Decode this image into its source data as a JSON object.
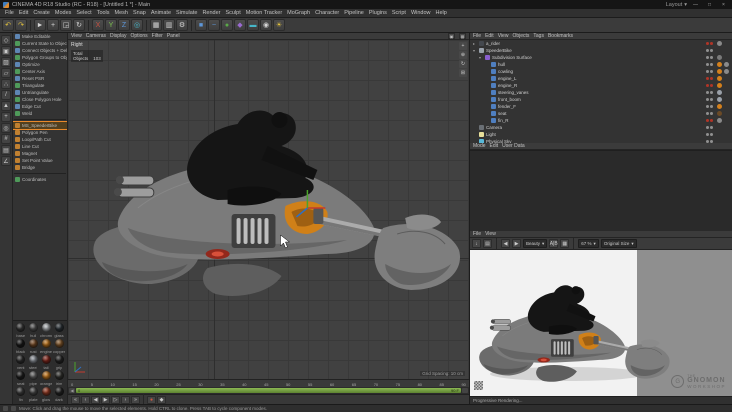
{
  "titlebar": {
    "app_title": "CINEMA 4D R18 Studio (RC - R18) - [Untitled 1 *] - Main",
    "layout_label": "Layout",
    "minimize": "—",
    "maximize": "□",
    "close": "×"
  },
  "menubar": {
    "items": [
      "File",
      "Edit",
      "Create",
      "Modes",
      "Select",
      "Tools",
      "Mesh",
      "Snap",
      "Animate",
      "Simulate",
      "Render",
      "Sculpt",
      "Motion Tracker",
      "MoGraph",
      "Character",
      "Pipeline",
      "Plugins",
      "Script",
      "Window",
      "Help"
    ]
  },
  "icons": {
    "undo": "↶",
    "redo": "↷",
    "select": "►",
    "move": "+",
    "scale": "◲",
    "rotate": "↻",
    "lock_x": "X",
    "lock_y": "Y",
    "lock_z": "Z",
    "coord_sys": "◎",
    "render_active": "▦",
    "render_pv": "▥",
    "render_settings": "⚙",
    "add_cube": "■",
    "add_spline": "~",
    "add_sds": "●",
    "add_deformer": "◆",
    "add_env": "▬",
    "add_camera": "◉",
    "add_light": "☀",
    "mode_make_editable": "◇",
    "mode_model": "▣",
    "mode_texture": "▨",
    "mode_workplane": "▱",
    "mode_points": "∴",
    "mode_edges": "/",
    "mode_polys": "▲",
    "mode_axis": "+",
    "mode_solo": "◎",
    "mode_snap": "#",
    "mode_lock": "▤",
    "mode_quantize": "∠",
    "nav_pan": "+",
    "nav_zoom": "⊕",
    "nav_rotate": "↻",
    "nav_max": "⊞",
    "panel_single": "▣",
    "panel_quad": "▦",
    "tp_start": "«",
    "tp_prevkey": "‹",
    "tp_prev": "◀",
    "tp_play": "▶",
    "tp_next": "▷",
    "tp_nextkey": "›",
    "tp_end": "»",
    "tp_record": "●",
    "tp_key": "◆",
    "rv_save": "↓",
    "rv_copy": "▤",
    "rv_back": "◀",
    "rv_fwd": "▶",
    "rv_ab": "A|B",
    "rv_grid": "▦",
    "dd_arrow": "▾",
    "wm_g": "G"
  },
  "left_panel": {
    "items": [
      "Make Editable",
      "Current State to Object",
      "Connect Objects + Delete",
      "Polygon Groups to Objects",
      "Optimize",
      "Center Axis",
      "Reset PSR",
      "Triangulate",
      "Untriangulate",
      "Close Polygon Hole",
      "Edge Cut",
      "Weld",
      "MS_SpeederBike",
      "Polygon Pen",
      "Loop/Path Cut",
      "Line Cut",
      "Magnet",
      "Set Point Value",
      "Bridge",
      "Coordinates"
    ]
  },
  "materials": {
    "items": [
      {
        "name": "base",
        "style": "--c:#3a3a3a"
      },
      {
        "name": "hull",
        "style": "--c:#565656"
      },
      {
        "name": "chrome",
        "style": "--c:#c0c4c8"
      },
      {
        "name": "glass",
        "style": "--c:#2a3238"
      },
      {
        "name": "black",
        "style": "--c:#141414"
      },
      {
        "name": "rust",
        "style": "--c:#7a4a22"
      },
      {
        "name": "engine",
        "style": "--c:#c87818"
      },
      {
        "name": "copper",
        "style": "--c:#8a5a28"
      },
      {
        "name": "vent",
        "style": "--c:#2e2e2e"
      },
      {
        "name": "steel",
        "style": "--c:#9aa0a8"
      },
      {
        "name": "tail",
        "style": "--c:#8a2418"
      },
      {
        "name": "grip",
        "style": "--c:#242424"
      },
      {
        "name": "seat",
        "style": "--c:#1a1a1a"
      },
      {
        "name": "pipe",
        "style": "--c:#6a6a6a"
      },
      {
        "name": "orange",
        "style": "--c:#d4801c"
      },
      {
        "name": "trim",
        "style": "--c:#32322e"
      },
      {
        "name": "fin",
        "style": "--c:#3e3e3e"
      },
      {
        "name": "plate",
        "style": "--c:#4a4a4a"
      },
      {
        "name": "glow",
        "style": "--c:#a03a20"
      },
      {
        "name": "dark",
        "style": "--c:#202020"
      }
    ]
  },
  "viewport": {
    "menu": [
      "View",
      "Cameras",
      "Display",
      "Options",
      "Filter",
      "Panel"
    ],
    "view_label": "Right",
    "hud": [
      {
        "label": "Total",
        "value": ""
      },
      {
        "label": "Objects",
        "value": "103"
      }
    ],
    "grid_label": "Grid Spacing: 10 cm"
  },
  "timeline": {
    "ticks": [
      "0",
      "5",
      "10",
      "15",
      "20",
      "25",
      "30",
      "35",
      "40",
      "45",
      "50",
      "55",
      "60",
      "65",
      "70",
      "75",
      "80",
      "85",
      "90"
    ],
    "range_start": "0",
    "range_end": "90 F"
  },
  "object_manager": {
    "menu": [
      "File",
      "Edit",
      "View",
      "Objects",
      "Tags",
      "Bookmarks"
    ],
    "items": [
      {
        "name": "a_rider",
        "arrow": "▸",
        "indent": "padding-left:3px",
        "icon": "--c:#44484e",
        "dots": "--d1:#b13527;--d2:#b13527",
        "tag1": "--t:#8a8a8a",
        "tag2": ""
      },
      {
        "name": "SpeederBike",
        "arrow": "▾",
        "indent": "padding-left:3px",
        "icon": "--c:#9aa2ac",
        "dots": "--d1:#909090;--d2:#909090",
        "tag1": "",
        "tag2": ""
      },
      {
        "name": "Subdivision Surface",
        "arrow": "▾",
        "indent": "padding-left:9px",
        "icon": "--c:#8a5fd0",
        "dots": "--d1:#909090;--d2:#909090",
        "tag1": "--t:#7a7a7a",
        "tag2": ""
      },
      {
        "name": "hull",
        "arrow": "",
        "indent": "padding-left:15px",
        "icon": "--c:#4f7fc0",
        "dots": "--d1:#909090;--d2:#909090",
        "tag1": "--t:#d4801c",
        "tag2": "--t:#8a8a8a"
      },
      {
        "name": "cowling",
        "arrow": "",
        "indent": "padding-left:15px",
        "icon": "--c:#4f7fc0",
        "dots": "--d1:#909090;--d2:#909090",
        "tag1": "--t:#d4801c",
        "tag2": "--t:#8a8a8a"
      },
      {
        "name": "engine_L",
        "arrow": "",
        "indent": "padding-left:15px",
        "icon": "--c:#4f7fc0",
        "dots": "--d1:#b13527;--d2:#b13527",
        "tag1": "--t:#d4801c",
        "tag2": ""
      },
      {
        "name": "engine_R",
        "arrow": "",
        "indent": "padding-left:15px",
        "icon": "--c:#4f7fc0",
        "dots": "--d1:#b13527;--d2:#b13527",
        "tag1": "--t:#d4801c",
        "tag2": ""
      },
      {
        "name": "steering_vanes",
        "arrow": "",
        "indent": "padding-left:15px",
        "icon": "--c:#4f7fc0",
        "dots": "--d1:#909090;--d2:#909090",
        "tag1": "--t:#9aa0a8",
        "tag2": ""
      },
      {
        "name": "front_boom",
        "arrow": "",
        "indent": "padding-left:15px",
        "icon": "--c:#4f7fc0",
        "dots": "--d1:#909090;--d2:#909090",
        "tag1": "--t:#9aa0a8",
        "tag2": ""
      },
      {
        "name": "fender_F",
        "arrow": "",
        "indent": "padding-left:15px",
        "icon": "--c:#4f7fc0",
        "dots": "--d1:#909090;--d2:#909090",
        "tag1": "--t:#d4801c",
        "tag2": ""
      },
      {
        "name": "seat",
        "arrow": "",
        "indent": "padding-left:15px",
        "icon": "--c:#4f7fc0",
        "dots": "--d1:#909090;--d2:#909090",
        "tag1": "--t:#6b4a26",
        "tag2": ""
      },
      {
        "name": "fin_R",
        "arrow": "",
        "indent": "padding-left:15px",
        "icon": "--c:#4f7fc0",
        "dots": "--d1:#b13527;--d2:#b13527",
        "tag1": "--t:#8a8a8a",
        "tag2": ""
      },
      {
        "name": "Camera",
        "arrow": "",
        "indent": "padding-left:3px",
        "icon": "--c:#6a6f75",
        "dots": "--d1:#909090;--d2:#909090",
        "tag1": "",
        "tag2": ""
      },
      {
        "name": "Light",
        "arrow": "",
        "indent": "padding-left:3px",
        "icon": "--c:#e8df9a",
        "dots": "--d1:#909090;--d2:#909090",
        "tag1": "",
        "tag2": ""
      },
      {
        "name": "Physical Sky",
        "arrow": "",
        "indent": "padding-left:3px",
        "icon": "--c:#58b8d8",
        "dots": "--d1:#909090;--d2:#909090",
        "tag1": "",
        "tag2": ""
      }
    ]
  },
  "attribute_manager": {
    "menu": [
      "Mode",
      "Edit",
      "User Data"
    ]
  },
  "render_view": {
    "menu": [
      "File",
      "View"
    ],
    "pass": "Beauty",
    "zoom": "67 %",
    "fit": "Original Size",
    "status": "Progressive Rendering...",
    "watermark": {
      "the": "THE",
      "name": "GNOMON",
      "sub": "WORKSHOP"
    }
  },
  "statusbar": {
    "hint": "Move: Click and drag the mouse to move the selected elements. Hold CTRL to clone. Press TAB to cycle component modes."
  }
}
